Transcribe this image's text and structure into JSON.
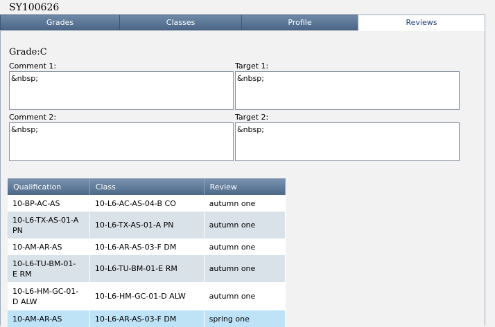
{
  "student_id": "SY100626",
  "tabs": [
    {
      "label": "Grades"
    },
    {
      "label": "Classes"
    },
    {
      "label": "Profile"
    },
    {
      "label": "Reviews",
      "active": true
    }
  ],
  "grade_label": "Grade:C",
  "comment1": {
    "label": "Comment 1:",
    "value": "&nbsp;"
  },
  "target1": {
    "label": "Target 1:",
    "value": "&nbsp;"
  },
  "comment2": {
    "label": "Comment 2:",
    "value": "&nbsp;"
  },
  "target2": {
    "label": "Target 2:",
    "value": "&nbsp;"
  },
  "table": {
    "headers": [
      "Qualification",
      "Class",
      "Review"
    ],
    "rows": [
      {
        "qualification": "10-BP-AC-AS",
        "class": "10-L6-AC-AS-04-B CO",
        "review": "autumn one"
      },
      {
        "qualification": "10-L6-TX-AS-01-A PN",
        "class": "10-L6-TX-AS-01-A PN",
        "review": "autumn one"
      },
      {
        "qualification": "10-AM-AR-AS",
        "class": "10-L6-AR-AS-03-F DM",
        "review": "autumn one"
      },
      {
        "qualification": "10-L6-TU-BM-01-E RM",
        "class": "10-L6-TU-BM-01-E RM",
        "review": "autumn one"
      },
      {
        "qualification": "10-L6-HM-GC-01-D ALW",
        "class": "10-L6-HM-GC-01-D ALW",
        "review": "autumn one"
      },
      {
        "qualification": "10-AM-AR-AS",
        "class": "10-L6-AR-AS-03-F DM",
        "review": "spring one"
      }
    ]
  }
}
